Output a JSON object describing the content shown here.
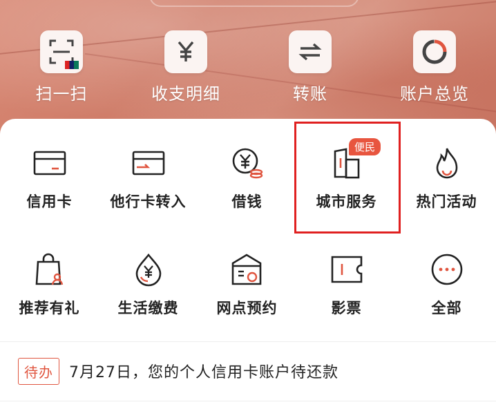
{
  "quick_actions": [
    {
      "label": "扫一扫",
      "icon": "scan-icon",
      "sublabel": "UnionPay"
    },
    {
      "label": "收支明细",
      "icon": "yen-icon"
    },
    {
      "label": "转账",
      "icon": "transfer-icon"
    },
    {
      "label": "账户总览",
      "icon": "donut-chart-icon"
    }
  ],
  "services_row1": [
    {
      "label": "信用卡",
      "icon": "credit-card-icon"
    },
    {
      "label": "他行卡转入",
      "icon": "card-transfer-in-icon"
    },
    {
      "label": "借钱",
      "icon": "borrow-money-icon"
    },
    {
      "label": "城市服务",
      "icon": "city-service-icon",
      "badge": "便民"
    },
    {
      "label": "热门活动",
      "icon": "flame-icon"
    }
  ],
  "services_row2": [
    {
      "label": "推荐有礼",
      "icon": "gift-bag-icon"
    },
    {
      "label": "生活缴费",
      "icon": "water-drop-yen-icon"
    },
    {
      "label": "网点预约",
      "icon": "branch-appointment-icon"
    },
    {
      "label": "影票",
      "icon": "movie-ticket-icon"
    },
    {
      "label": "全部",
      "icon": "more-dots-icon"
    }
  ],
  "todo": {
    "tag": "待办",
    "message": "7月27日，您的个人信用卡账户待还款"
  },
  "colors": {
    "accent": "#e0553f",
    "highlight": "#e02020"
  }
}
